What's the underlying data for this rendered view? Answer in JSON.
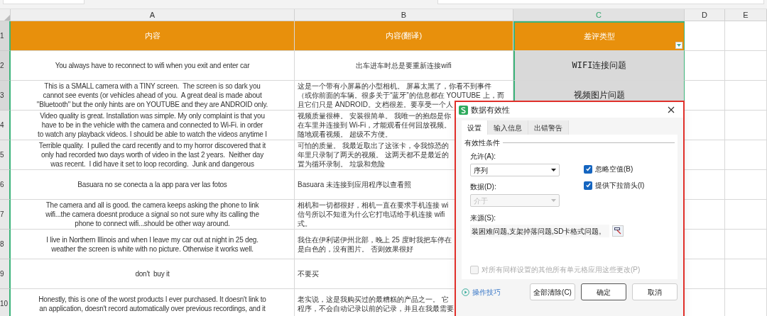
{
  "columns": [
    {
      "label": "A",
      "selected": false
    },
    {
      "label": "B",
      "selected": false
    },
    {
      "label": "C",
      "selected": true
    },
    {
      "label": "D",
      "selected": false
    },
    {
      "label": "E",
      "selected": false
    }
  ],
  "rows": [
    {
      "number": "1",
      "kind": "header",
      "cells": [
        {
          "text": "内容"
        },
        {
          "text": "内容(翻译)"
        },
        {
          "text": "差评类型",
          "dropdown": true
        }
      ]
    },
    {
      "number": "2",
      "kind": "data",
      "cells": [
        {
          "text": "You always have to reconnect to wifi when you exit and enter car"
        },
        {
          "text": "出车进车时总是要重新连接wifi"
        },
        {
          "text": "WIFI连接问题"
        }
      ]
    },
    {
      "number": "3",
      "kind": "data",
      "cells": [
        {
          "text": "This is a SMALL camera with a TINY screen.  The screen is so dark you\ncannot see events (or vehicles ahead of you.  A great deal is made about\n\"Bluetooth\" but the only hints are on YOUTUBE and they are ANDROID only."
        },
        {
          "lines": [
            "这是一个带有小屏幕的小型相机。 屏幕太黑了，你看不到事件",
            "（或你前面的车辆。很多关于“蓝牙”的信息都在 YOUTUBE 上，而",
            "且它们只是 ANDROID。文档很差。要享受一个人"
          ]
        },
        {
          "text": "视频图片问题"
        }
      ]
    },
    {
      "number": "4",
      "kind": "data",
      "cells": [
        {
          "text": "Video quality is great. Installation was simple. My only complaint is that you\nhave to be in the vehicle with the camera and connected to Wi-Fi. in order\nto watch any playback videos. I should be able to watch the videos anytime I"
        },
        {
          "lines": [
            "视频质量很棒。 安装很简单。 我唯一的抱怨是你",
            "在车里并连接到 Wi-Fi，才能观看任何回放视频。",
            "随地观看视频。 超级不方便。"
          ]
        }
      ]
    },
    {
      "number": "5",
      "kind": "data",
      "cells": [
        {
          "text": "Terrible quality.  I pulled the card recently and to my horror discovered that it\nonly had recorded two days worth of video in the last 2 years.  Neither day\nwas recent.  I did have it set to loop recording.  Junk and dangerous"
        },
        {
          "lines": [
            "可怕的质量。 我最近取出了这张卡，令我惊恐的",
            "年里只录制了两天的视频。 这两天都不是最近的",
            "置为循环录制。 垃圾和危险"
          ]
        }
      ]
    },
    {
      "number": "6",
      "kind": "data",
      "cells": [
        {
          "text": "Basuara no se conecta a la app para ver las fotos"
        },
        {
          "text": "Basuara 未连接到应用程序以查看照"
        }
      ]
    },
    {
      "number": "7",
      "kind": "data",
      "cells": [
        {
          "text": "The camera and all is good. the camera keeps asking the phone to link\nwifi...the camera doesnt produce a signal so not sure why its calling the\nphone to connect wifi...should be other way around."
        },
        {
          "lines": [
            "相机和一切都很好，相机一直在要求手机连接 wi",
            "信号所以不知道为什么它打电话给手机连接 wifi",
            "式。"
          ]
        }
      ]
    },
    {
      "number": "8",
      "kind": "data",
      "cells": [
        {
          "text": "I live in Northern Illinois and when I leave my car out at night in 25 deg.\nweather the screen is white with no picture. Otherwise it works well."
        },
        {
          "lines": [
            "我住在伊利诺伊州北部，晚上 25 度时我把车停在",
            "是白色的，没有图片。 否则效果很好"
          ]
        }
      ]
    },
    {
      "number": "9",
      "kind": "data",
      "cells": [
        {
          "text": "don't  buy it"
        },
        {
          "text": "不要买"
        }
      ]
    },
    {
      "number": "10",
      "kind": "data",
      "cells": [
        {
          "text": "Honestly, this is one of the worst products I ever purchased. It doesn't link to\nan application, doesn't record automatically over previous recordings, and it"
        },
        {
          "lines": [
            "老实说，这是我购买过的最糟糕的产品之一。 它",
            "程序，不会自动记录以前的记录，并且在我最需要"
          ]
        }
      ]
    }
  ],
  "dialog": {
    "title": "数据有效性",
    "tabs": [
      {
        "label": "设置",
        "selected": true
      },
      {
        "label": "输入信息",
        "selected": false
      },
      {
        "label": "出错警告",
        "selected": false
      }
    ],
    "group_title": "有效性条件",
    "allow": {
      "label": "允许(A):",
      "value": "序列",
      "disabled": false
    },
    "data": {
      "label": "数据(D):",
      "value": "介于",
      "disabled": true
    },
    "checkboxes": [
      {
        "label": "忽略空值(B)",
        "checked": true
      },
      {
        "label": "提供下拉箭头(I)",
        "checked": true
      }
    ],
    "source": {
      "label": "来源(S):",
      "value": "装困难问题,支架掉落问题,SD卡格式问题,"
    },
    "apply_all": {
      "label": "对所有同样设置的其他所有单元格应用这些更改(P)",
      "checked": false,
      "disabled": true
    },
    "tips_link": "操作技巧",
    "buttons": [
      "全部清除(C)",
      "确定",
      "取消"
    ]
  }
}
